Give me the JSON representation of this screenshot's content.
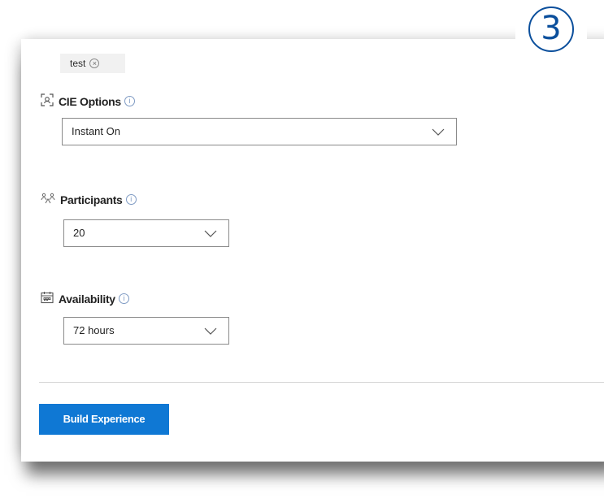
{
  "step_badge": {
    "number": "3"
  },
  "tag": {
    "label": "test",
    "remove_glyph": "⊗"
  },
  "cie_options": {
    "label": "CIE Options",
    "icon": "scan-icon",
    "selected": "Instant On"
  },
  "participants": {
    "label": "Participants",
    "icon": "people-icon",
    "selected": "20"
  },
  "availability": {
    "label": "Availability",
    "icon": "calendar-icon",
    "selected": "72 hours"
  },
  "actions": {
    "build_label": "Build Experience"
  },
  "colors": {
    "accent": "#0f78d4",
    "badge": "#0b4f9c",
    "info": "#7e9ac3"
  }
}
